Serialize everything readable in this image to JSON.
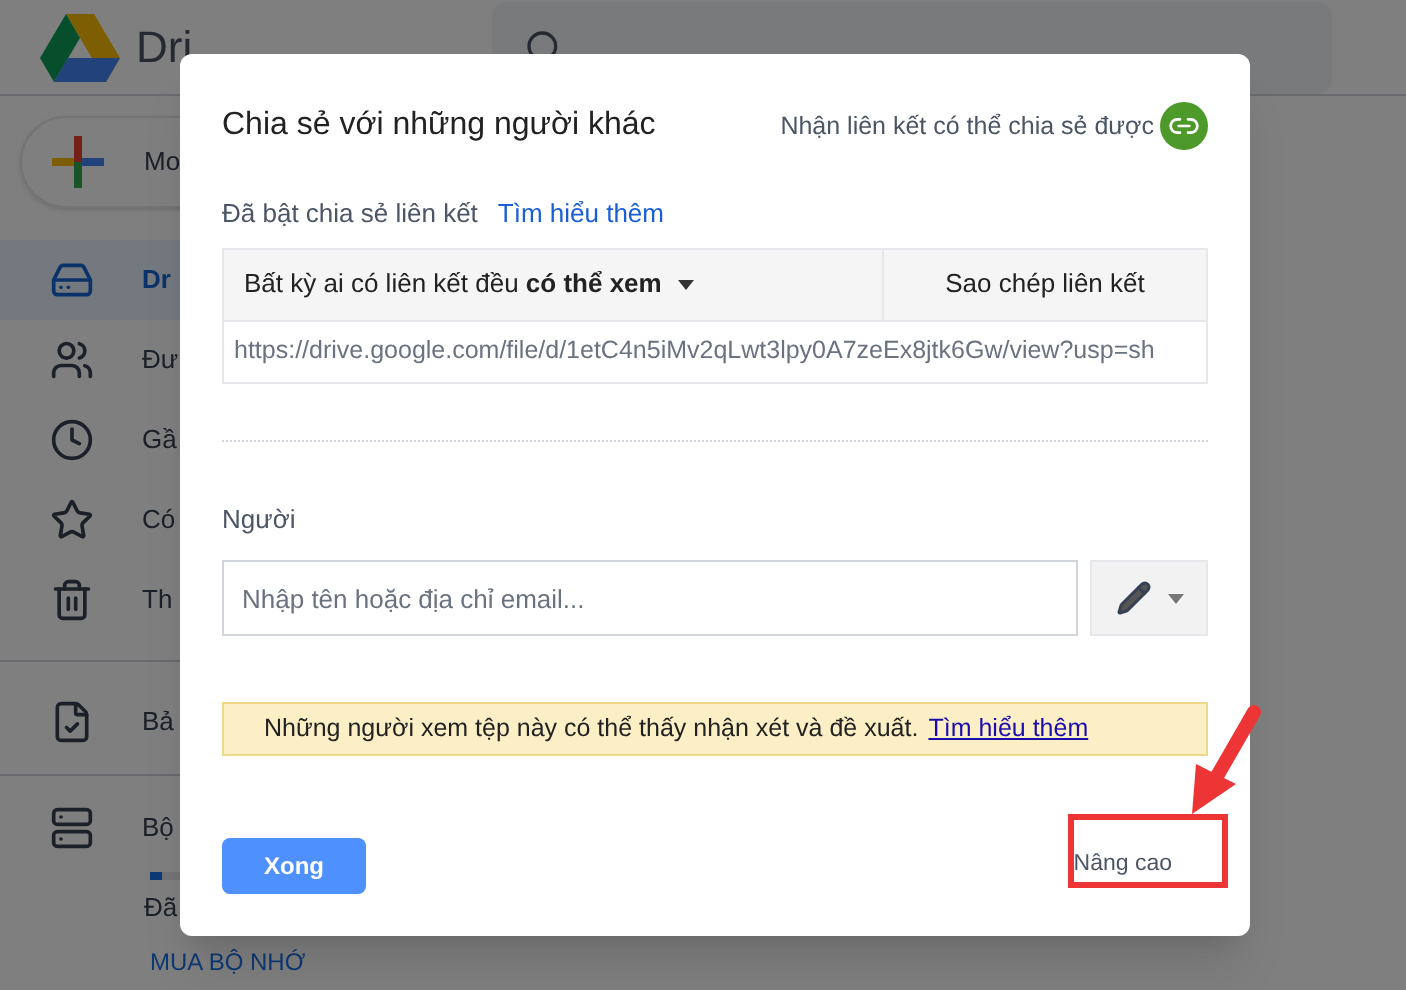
{
  "app": {
    "logo_text": "Dri",
    "new_button": "Mo"
  },
  "sidebar": {
    "items": [
      {
        "label": "Dr",
        "selected": true
      },
      {
        "label": "Đư",
        "selected": false
      },
      {
        "label": "Gầ",
        "selected": false
      },
      {
        "label": "Có",
        "selected": false
      },
      {
        "label": "Th",
        "selected": false
      },
      {
        "label": "Bả",
        "selected": false
      },
      {
        "label": "Bộ",
        "selected": false
      }
    ],
    "storage": {
      "level": 0.05,
      "text": "Đã"
    },
    "buy_link": "MUA BỘ NHỚ"
  },
  "dialog": {
    "title": "Chia sẻ với những người khác",
    "get_link": "Nhận liên kết có thể chia sẻ được",
    "link_status": "Đã bật chia sẻ liên kết",
    "learn_more": "Tìm hiểu thêm",
    "access_dropdown": "Bất kỳ ai có liên kết đều **có thể xem**",
    "copy_link": "Sao chép liên kết",
    "url": "https://drive.google.com/file/d/1etC4n5iMv2qLwt3lpy0A7zeEx8jtk6Gw/view?usp=sh",
    "people_label": "Người",
    "people_placeholder": "Nhập tên hoặc địa chỉ email...",
    "notice": "Những người xem tệp này có thể thấy nhận xét và đề xuất.",
    "notice_link": "Tìm hiểu thêm",
    "done_button": "Xong",
    "advanced_button": "Nâng cao"
  }
}
